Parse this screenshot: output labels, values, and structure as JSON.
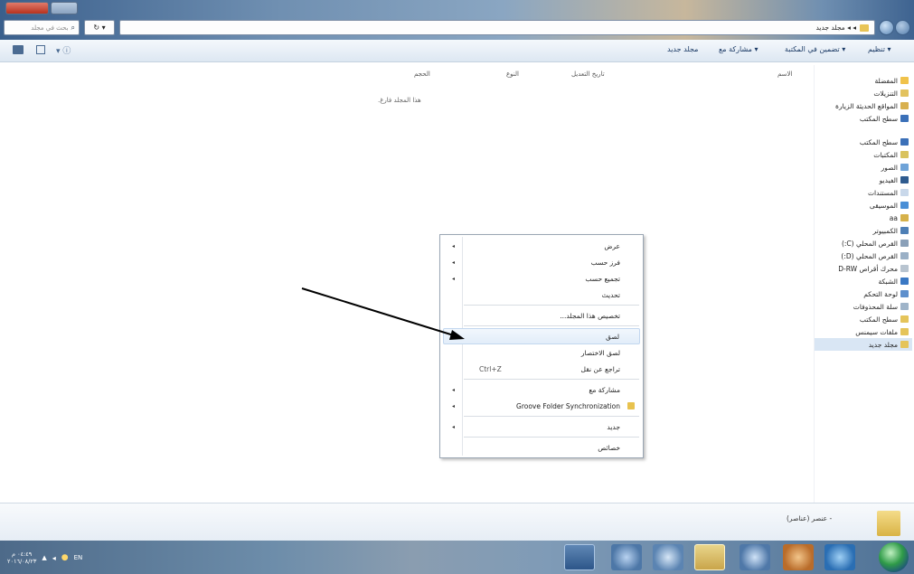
{
  "window": {
    "address_path": "◂ ◂ مجلد جديد",
    "search_placeholder": "بحث في مجلد"
  },
  "toolbar": {
    "organize": "تنظيم ▾",
    "include_in_library": "تضمين في المكتبة ▾",
    "share_with": "مشاركة مع ▾",
    "new_folder": "مجلد جديد"
  },
  "columns": {
    "name": "الاسم",
    "date_modified": "تاريخ التعديل",
    "type": "النوع",
    "size": "الحجم"
  },
  "empty_folder_text": "هذا المجلد فارغ.",
  "navigation": {
    "items": [
      {
        "label": "المفضلة",
        "icon": "star-icon"
      },
      {
        "label": "التنزيلات",
        "icon": "folder-icon"
      },
      {
        "label": "المواقع الحديثة الزيارة",
        "icon": "recent-icon"
      },
      {
        "label": "سطح المكتب",
        "icon": "desktop-icon"
      },
      {
        "label": "سطح المكتب",
        "icon": "desktop-icon"
      },
      {
        "label": "المكتبات",
        "icon": "library-icon"
      },
      {
        "label": "الصور",
        "icon": "pictures-icon"
      },
      {
        "label": "الفيديو",
        "icon": "video-icon"
      },
      {
        "label": "المستندات",
        "icon": "documents-icon"
      },
      {
        "label": "الموسيقى",
        "icon": "music-icon"
      },
      {
        "label": "aa",
        "icon": "user-icon"
      },
      {
        "label": "الكمبيوتر",
        "icon": "computer-icon"
      },
      {
        "label": "القرص المحلي (C:)",
        "icon": "drive-icon"
      },
      {
        "label": "القرص المحلي (D:)",
        "icon": "drive-icon"
      },
      {
        "label": "محرك أقراص D-RW",
        "icon": "dvd-icon"
      },
      {
        "label": "الشبكة",
        "icon": "network-icon"
      },
      {
        "label": "لوحة التحكم",
        "icon": "control-panel-icon"
      },
      {
        "label": "سلة المحذوفات",
        "icon": "recycle-bin-icon"
      },
      {
        "label": "سطح المكتب",
        "icon": "folder-icon"
      },
      {
        "label": "ملفات سيمنس",
        "icon": "folder-icon"
      },
      {
        "label": "مجلد جديد",
        "icon": "folder-icon"
      }
    ]
  },
  "context_menu": {
    "items": [
      {
        "label": "عرض",
        "submenu": true
      },
      {
        "label": "فرز حسب",
        "submenu": true
      },
      {
        "label": "تجميع حسب",
        "submenu": true
      },
      {
        "label": "تحديث"
      },
      {
        "label": "تخصيص هذا المجلد...",
        "separator_before": true
      },
      {
        "label": "لصق",
        "highlighted": true,
        "separator_before": true
      },
      {
        "label": "لصق الاختصار"
      },
      {
        "label": "تراجع عن نقل",
        "shortcut": "Ctrl+Z"
      },
      {
        "label": "مشاركة مع",
        "submenu": true,
        "separator_before": true
      },
      {
        "label": "Groove Folder Synchronization",
        "submenu": true
      },
      {
        "label": "جديد",
        "submenu": true,
        "separator_before": true
      },
      {
        "label": "خصائص",
        "separator_before": true
      }
    ]
  },
  "details_pane": {
    "text": "- عنصر (عناصر)"
  },
  "taskbar": {
    "clock_time": "٠٤:٤٩ م",
    "clock_date": "٢٠١٦/٠٨/٢٣",
    "language": "EN"
  },
  "colors": {
    "accent": "#1c3b66",
    "highlight": "#e2edf9",
    "arrow": "#000000"
  }
}
